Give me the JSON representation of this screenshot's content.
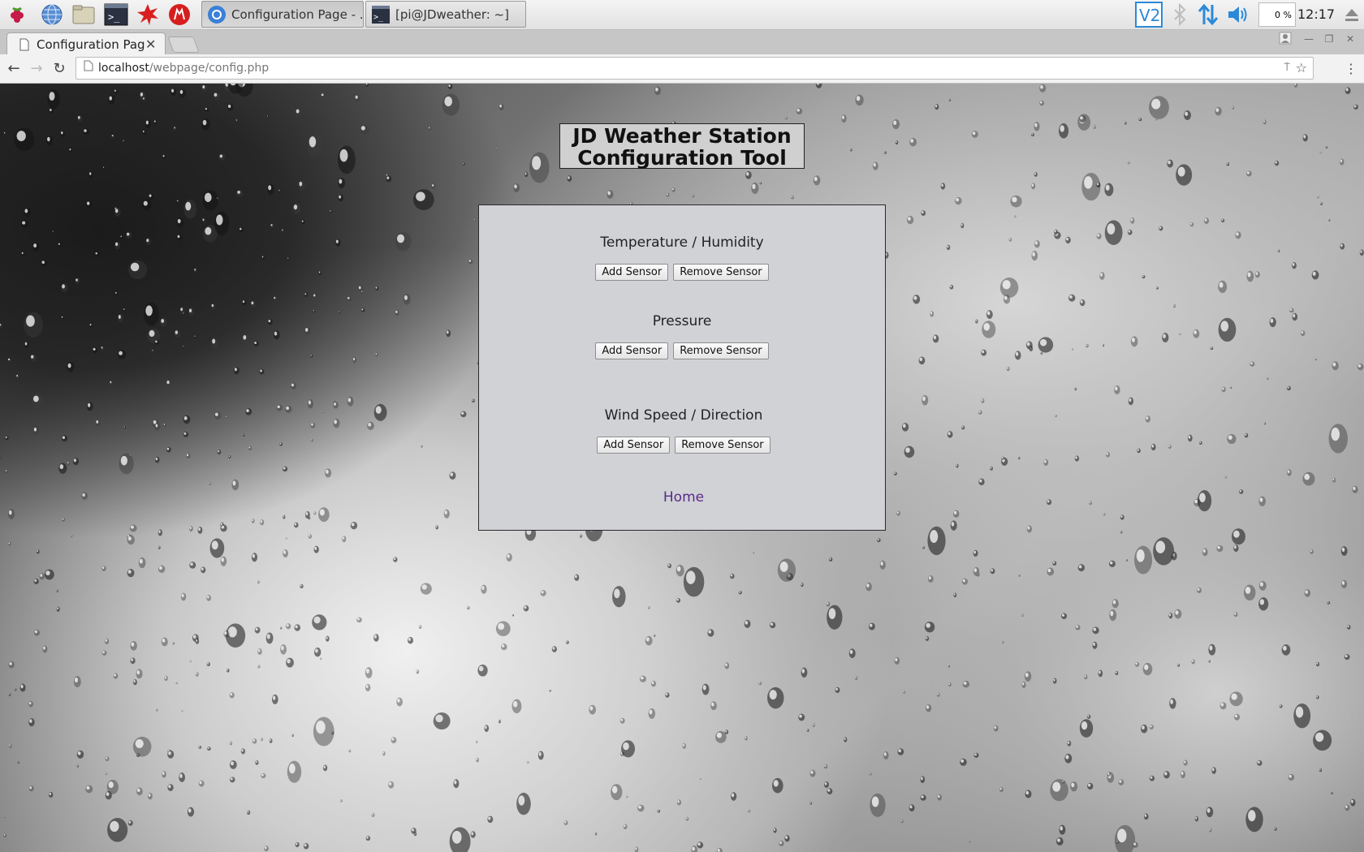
{
  "taskbar": {
    "tasks": [
      {
        "label": "Configuration Page - ..."
      },
      {
        "label": "[pi@JDweather: ~]"
      }
    ],
    "cpu": "0 %",
    "clock": "12:17"
  },
  "browser": {
    "tab_title": "Configuration Pag",
    "url_host": "localhost",
    "url_path": "/webpage/config.php"
  },
  "page": {
    "title_line1": "JD Weather Station",
    "title_line2": "Configuration Tool",
    "sections": [
      {
        "title": "Temperature / Humidity",
        "add": "Add Sensor",
        "remove": "Remove Sensor"
      },
      {
        "title": "Pressure",
        "add": "Add Sensor",
        "remove": "Remove Sensor"
      },
      {
        "title": "Wind Speed / Direction",
        "add": "Add Sensor",
        "remove": "Remove Sensor"
      }
    ],
    "home_link": "Home"
  },
  "colors": {
    "panel": "#d0d2d6",
    "link": "#5a2a8a",
    "taskbar_accent": "#2b8ad8"
  }
}
